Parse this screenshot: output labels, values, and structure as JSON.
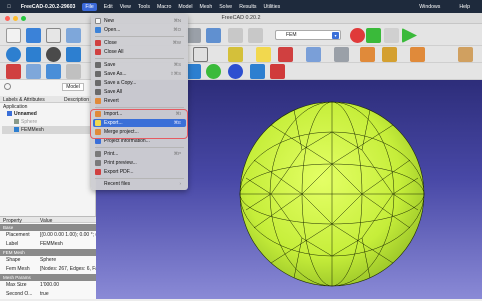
{
  "menubar": {
    "apple": "",
    "app": "FreeCAD-0.20.2-29603",
    "items": [
      "File",
      "Edit",
      "View",
      "Tools",
      "Macro",
      "Model",
      "Mesh",
      "Solve",
      "Results",
      "Utilities"
    ],
    "right": [
      "Windows",
      "Help"
    ]
  },
  "window": {
    "title": "FreeCAD 0.20.2"
  },
  "workbench": {
    "selected": "FEM"
  },
  "model_tab": "Model",
  "tree": {
    "headers": [
      "Labels & Attributes",
      "Description"
    ],
    "application": "Application",
    "doc": "Unnamed",
    "sphere": "Sphere",
    "femmesh": "FEMMesh"
  },
  "file_menu": {
    "items": [
      {
        "label": "New",
        "shortcut": "⌘N",
        "icon": "new-file-icon"
      },
      {
        "label": "Open...",
        "shortcut": "⌘O",
        "icon": "open-folder-icon"
      },
      {
        "label": "Close",
        "shortcut": "⌘W",
        "icon": "close-doc-icon"
      },
      {
        "label": "Close All",
        "shortcut": "",
        "icon": "close-all-icon"
      },
      {
        "label": "Save",
        "shortcut": "⌘S",
        "icon": "save-icon"
      },
      {
        "label": "Save As...",
        "shortcut": "⇧⌘S",
        "icon": "save-as-icon"
      },
      {
        "label": "Save a Copy...",
        "shortcut": "",
        "icon": "save-copy-icon"
      },
      {
        "label": "Save All",
        "shortcut": "",
        "icon": "save-all-icon"
      },
      {
        "label": "Revert",
        "shortcut": "",
        "icon": "revert-icon"
      },
      {
        "label": "Import...",
        "shortcut": "⌘I",
        "icon": "import-icon"
      },
      {
        "label": "Export...",
        "shortcut": "⌘E",
        "icon": "export-icon"
      },
      {
        "label": "Merge project...",
        "shortcut": "",
        "icon": "merge-icon"
      },
      {
        "label": "Project information...",
        "shortcut": "",
        "icon": "info-icon"
      },
      {
        "label": "Print...",
        "shortcut": "⌘P",
        "icon": "print-icon"
      },
      {
        "label": "Print preview...",
        "shortcut": "",
        "icon": "print-preview-icon"
      },
      {
        "label": "Export PDF...",
        "shortcut": "",
        "icon": "pdf-icon"
      },
      {
        "label": "Recent files",
        "shortcut": "›",
        "icon": ""
      }
    ]
  },
  "props": {
    "headers": [
      "Property",
      "Value"
    ],
    "groups": {
      "base": "Base",
      "fem": "FEM Mesh",
      "params": "Mesh Params"
    },
    "rows": [
      {
        "k": "Placement",
        "v": "[(0.00 0.00 1.00); 0.00 °; (0.00 mm  0.00 mm  0.0..."
      },
      {
        "k": "Label",
        "v": "FEMMesh"
      },
      {
        "k": "Shape",
        "v": "Sphere"
      },
      {
        "k": "Fem Mesh",
        "v": "[Nodes: 267, Edges: 6, Faces: 108, Polygons: 0, V..."
      },
      {
        "k": "Max Size",
        "v": "1'000.00"
      },
      {
        "k": "Second O...",
        "v": "true"
      }
    ]
  },
  "colors": {
    "accent": "#3a6fd8",
    "highlight_box": "#e65b62",
    "mesh": "#c8f03c"
  }
}
